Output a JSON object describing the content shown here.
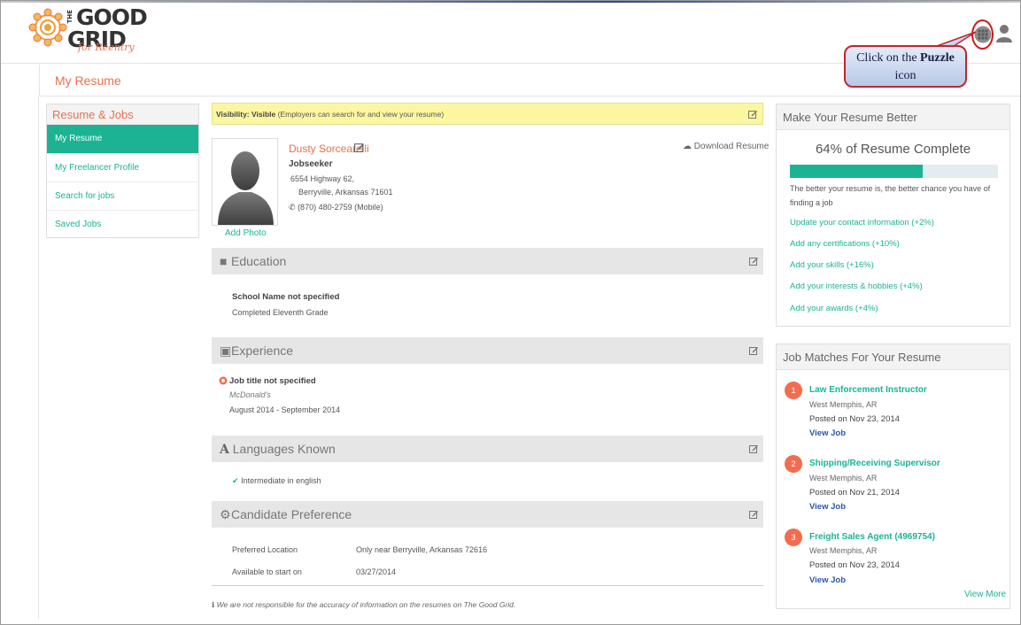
{
  "brand": {
    "logo_the": "THE",
    "logo_good": "GOOD",
    "logo_grid": "GRID",
    "logo_tagline": "for Reentry",
    "accent_color": "#1bb394",
    "orange_color": "#e8704e"
  },
  "header": {
    "puzzle_icon": "grid-puzzle-icon",
    "user_icon": "user-icon"
  },
  "callout": {
    "prefix": "Click on the ",
    "bold": "Puzzle",
    "suffix": "icon"
  },
  "page": {
    "title": "My Resume"
  },
  "sidebar": {
    "heading": "Resume & Jobs",
    "items": [
      {
        "label": "My Resume",
        "active": true
      },
      {
        "label": "My Freelancer Profile",
        "active": false
      },
      {
        "label": "Search for jobs",
        "active": false
      },
      {
        "label": "Saved Jobs",
        "active": false
      }
    ]
  },
  "visibility": {
    "label": "Visibility: Visible",
    "note": " (Employers can search for and view your resume)"
  },
  "profile": {
    "name": "Dusty Sorcearelli",
    "role": "Jobseeker",
    "address_line1": "6554 Highway 62,",
    "address_line2": "Berryville, Arkansas  71601",
    "phone": "(870) 480-2759 (Mobile)",
    "add_photo": "Add Photo",
    "download": "Download Resume"
  },
  "education": {
    "heading": "Education",
    "school": "School Name not specified",
    "grade": "Completed Eleventh Grade"
  },
  "experience": {
    "heading": "Experience",
    "title": "Job title not specified",
    "company": "McDonald's",
    "dates": "August 2014 - September 2014"
  },
  "languages": {
    "heading": "Languages Known",
    "heading_glyph": "A",
    "item": "Intermediate in english"
  },
  "preference": {
    "heading": "Candidate Preference",
    "rows": [
      {
        "label": "Preferred Location",
        "value": "Only near Berryville, Arkansas 72616"
      },
      {
        "label": "Available to start on",
        "value": "03/27/2014"
      }
    ]
  },
  "disclaimer": "We are not responsible for the accuracy of information on the resumes on The Good Grid.",
  "improve": {
    "heading": "Make Your Resume Better",
    "percent_text": "64% of Resume Complete",
    "percent": 64,
    "note": "The better your resume is, the better chance you have of finding a job",
    "tips": [
      "Update your contact information (+2%)",
      "Add any certifications (+10%)",
      "Add your skills (+16%)",
      "Add your interests & hobbies (+4%)",
      "Add your awards (+4%)"
    ]
  },
  "matches": {
    "heading": "Job Matches For Your Resume",
    "view_more": "View More",
    "jobs": [
      {
        "num": "1",
        "title": "Law Enforcement Instructor",
        "location": "West Memphis, AR",
        "posted": "Posted on Nov 23, 2014",
        "view": "View Job"
      },
      {
        "num": "2",
        "title": "Shipping/Receiving Supervisor",
        "location": "West Memphis, AR",
        "posted": "Posted on Nov 21, 2014",
        "view": "View Job"
      },
      {
        "num": "3",
        "title": "Freight Sales Agent (4969754)",
        "location": "West Memphis, AR",
        "posted": "Posted on Nov 23, 2014",
        "view": "View Job"
      }
    ]
  }
}
